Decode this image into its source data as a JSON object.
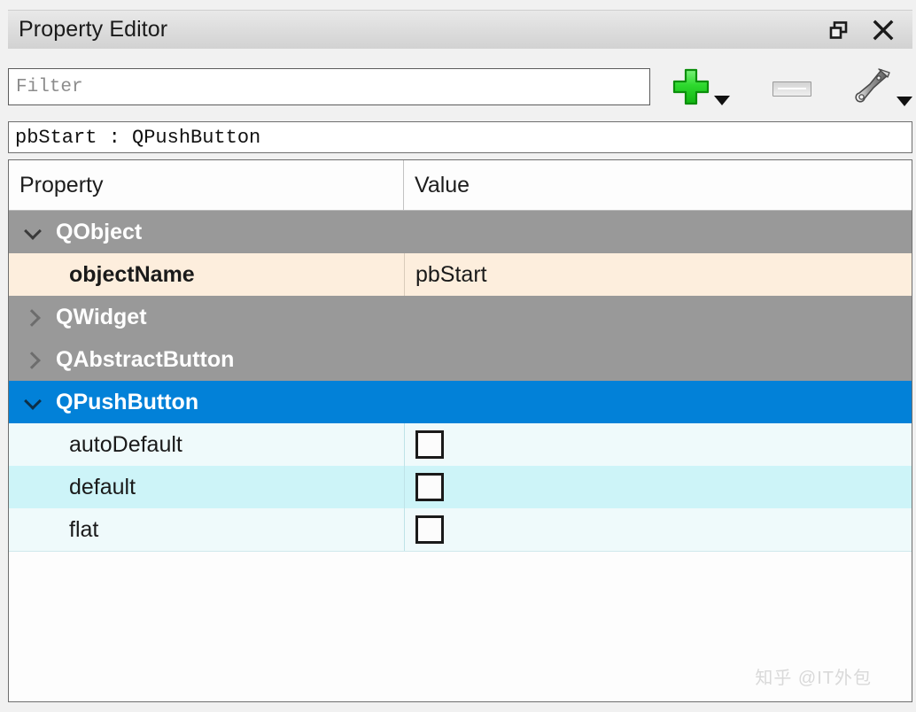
{
  "window": {
    "title": "Property Editor",
    "float_button": "float-restore",
    "close_button": "close"
  },
  "toolbar": {
    "filter_placeholder": "Filter",
    "filter_value": "",
    "add_button_label": "add-dynamic-property",
    "remove_button_label": "remove-dynamic-property",
    "configure_button_label": "configure-property-editor"
  },
  "object_selector": {
    "text": "pbStart : QPushButton"
  },
  "tree": {
    "columns": [
      "Property",
      "Value"
    ],
    "rows": [
      {
        "kind": "group",
        "label": "QObject",
        "expanded": true,
        "selected": false
      },
      {
        "kind": "property",
        "label": "objectName",
        "value": "pbStart",
        "value_type": "text",
        "style": "objectname"
      },
      {
        "kind": "group",
        "label": "QWidget",
        "expanded": false,
        "selected": false
      },
      {
        "kind": "group",
        "label": "QAbstractButton",
        "expanded": false,
        "selected": false
      },
      {
        "kind": "group",
        "label": "QPushButton",
        "expanded": true,
        "selected": true
      },
      {
        "kind": "property",
        "label": "autoDefault",
        "value": false,
        "value_type": "checkbox",
        "style": "alt-a"
      },
      {
        "kind": "property",
        "label": "default",
        "value": false,
        "value_type": "checkbox",
        "style": "alt-b"
      },
      {
        "kind": "property",
        "label": "flat",
        "value": false,
        "value_type": "checkbox",
        "style": "alt-a"
      }
    ]
  },
  "watermark": {
    "text": "知乎 @IT外包"
  },
  "colors": {
    "group_header": "#999999",
    "selected_row": "#0281d8",
    "objectname_row": "#fdeedd",
    "alt_row_a": "#effafb",
    "alt_row_b": "#cdf4f8",
    "add_icon_green": "#33dd33"
  }
}
